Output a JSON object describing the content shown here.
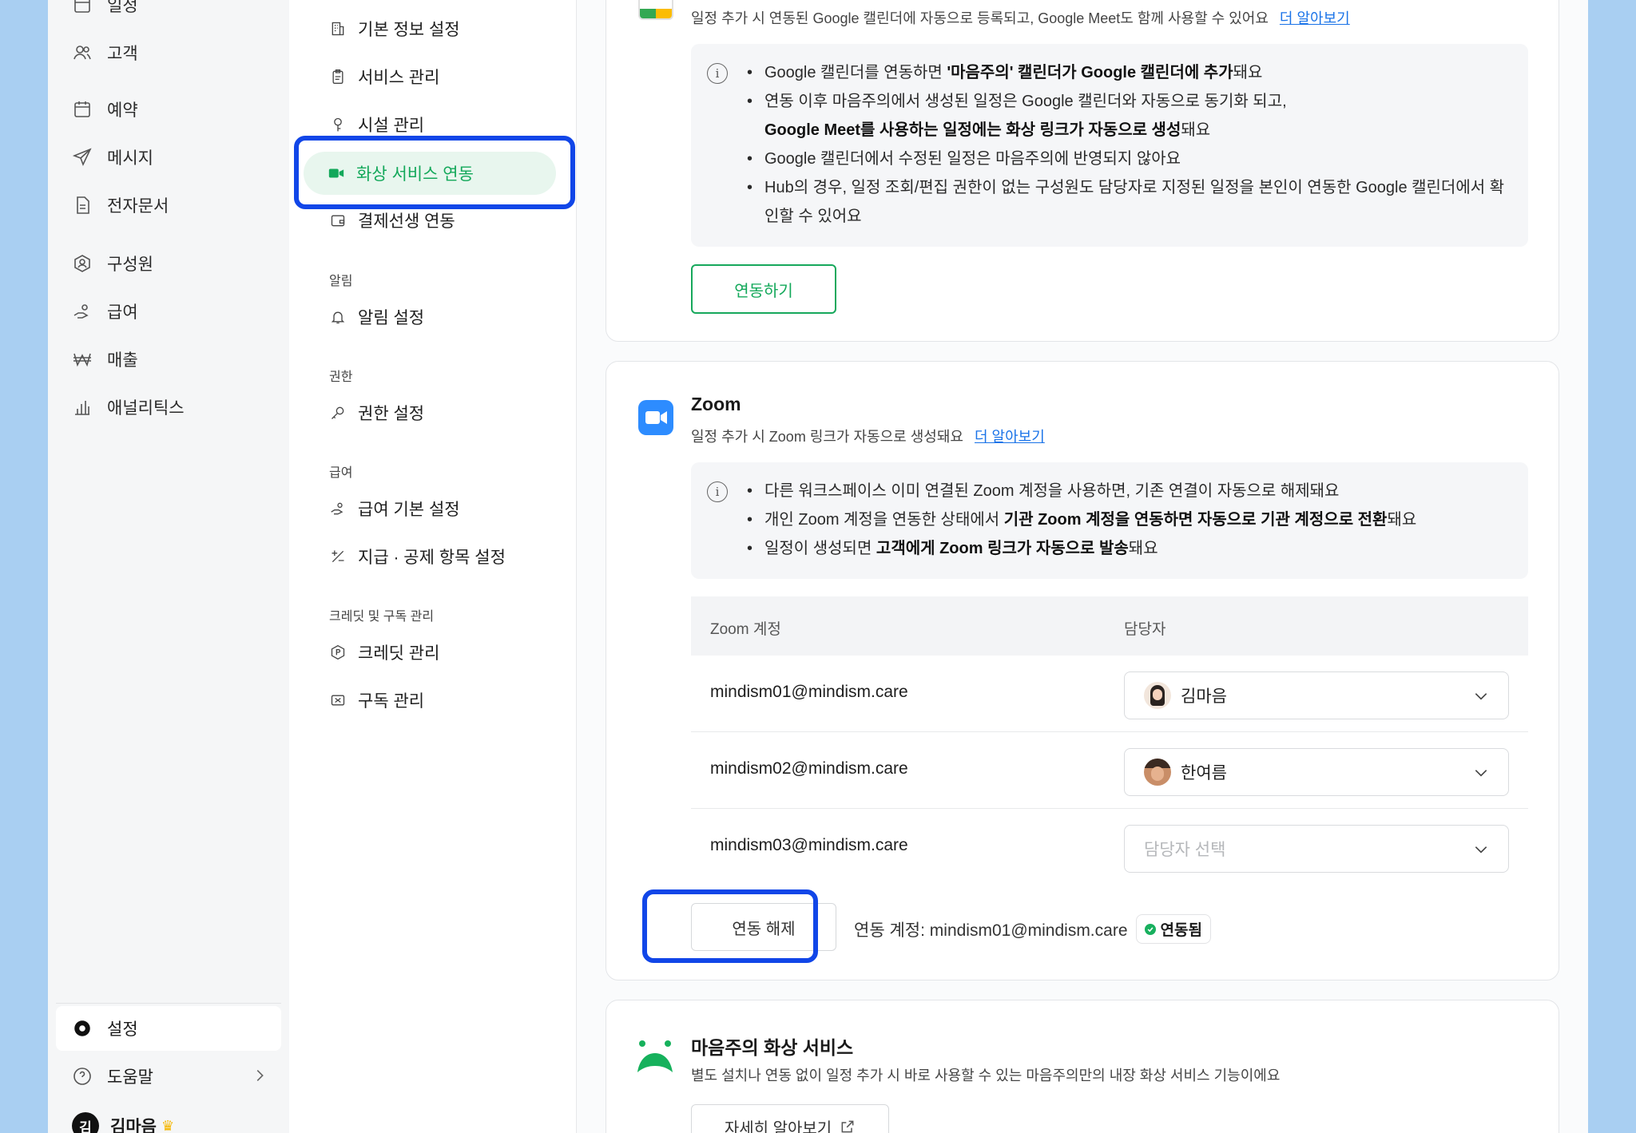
{
  "nav": {
    "items": [
      {
        "label": "일정",
        "icon": "calendar-31-icon"
      },
      {
        "label": "고객",
        "icon": "users-icon"
      },
      {
        "label": "예약",
        "icon": "calendar-icon"
      },
      {
        "label": "메시지",
        "icon": "send-icon"
      },
      {
        "label": "전자문서",
        "icon": "document-icon"
      },
      {
        "label": "구성원",
        "icon": "member-icon"
      },
      {
        "label": "급여",
        "icon": "hand-coin-icon"
      },
      {
        "label": "매출",
        "icon": "won-icon"
      },
      {
        "label": "애널리틱스",
        "icon": "bar-chart-icon"
      }
    ],
    "settings": "설정",
    "help": "도움말",
    "user": {
      "initial": "김",
      "name": "김마음"
    }
  },
  "subnav": {
    "items_top": [
      "기본 정보 설정",
      "서비스 관리",
      "시설 관리"
    ],
    "active": "화상 서비스 연동",
    "after_active": "결제선생 연동",
    "section_alert": "알림",
    "alert_item": "알림 설정",
    "section_perm": "권한",
    "perm_item": "권한 설정",
    "section_pay": "급여",
    "pay_items": [
      "급여 기본 설정",
      "지급 · 공제 항목 설정"
    ],
    "section_credit": "크레딧 및 구독 관리",
    "credit_items": [
      "크레딧 관리",
      "구독 관리"
    ]
  },
  "google": {
    "desc": "일정 추가 시 연동된 Google 캘린더에 자동으로 등록되고, Google Meet도 함께 사용할 수 있어요",
    "learn_more": "더 알아보기",
    "bullets": {
      "b1_pre": "Google 캘린더를 연동하면 ",
      "b1_bold": "'마음주의' 캘린더가 Google 캘린더에 추가",
      "b1_post": "돼요",
      "b2_line1": "연동 이후 마음주의에서 생성된 일정은 Google 캘린더와 자동으로 동기화 되고,",
      "b2_bold": "Google Meet를 사용하는 일정에는 화상 링크가 자동으로 생성",
      "b2_post": "돼요",
      "b3": "Google 캘린더에서 수정된 일정은 마음주의에 반영되지 않아요",
      "b4": "Hub의 경우, 일정 조회/편집 권한이 없는 구성원도 담당자로 지정된 일정을 본인이 연동한 Google 캘린더에서 확인할 수 있어요"
    },
    "connect_button": "연동하기"
  },
  "zoom": {
    "title": "Zoom",
    "desc": "일정 추가 시 Zoom 링크가 자동으로 생성돼요",
    "learn_more": "더 알아보기",
    "bullets": {
      "b1": "다른 워크스페이스 이미 연결된 Zoom 계정을 사용하면, 기존 연결이 자동으로 해제돼요",
      "b2_pre": "개인 Zoom 계정을 연동한 상태에서 ",
      "b2_bold": "기관 Zoom 계정을 연동하면 자동으로 기관 계정으로 전환",
      "b2_post": "돼요",
      "b3_pre": "일정이 생성되면 ",
      "b3_bold": "고객에게 Zoom 링크가 자동으로 발송",
      "b3_post": "돼요"
    },
    "table": {
      "col_account": "Zoom 계정",
      "col_manager": "담당자",
      "rows": [
        {
          "email": "mindism01@mindism.care",
          "manager": "김마음"
        },
        {
          "email": "mindism02@mindism.care",
          "manager": "한여름"
        },
        {
          "email": "mindism03@mindism.care",
          "manager": ""
        }
      ],
      "placeholder": "담당자 선택"
    },
    "disconnect_button": "연동 해제",
    "connected_account": "연동 계정: mindism01@mindism.care",
    "status_badge": "연동됨"
  },
  "internal": {
    "title": "마음주의 화상 서비스",
    "desc": "별도 설치나 연동 없이 일정 추가 시 바로 사용할 수 있는 마음주의만의 내장 화상 서비스 기능이에요",
    "details_button": "자세히 알아보기"
  },
  "colors": {
    "accent_green": "#13a85a",
    "highlight_blue": "#1146e8",
    "link_blue": "#1a73e8",
    "zoom_blue": "#2d8cff"
  }
}
